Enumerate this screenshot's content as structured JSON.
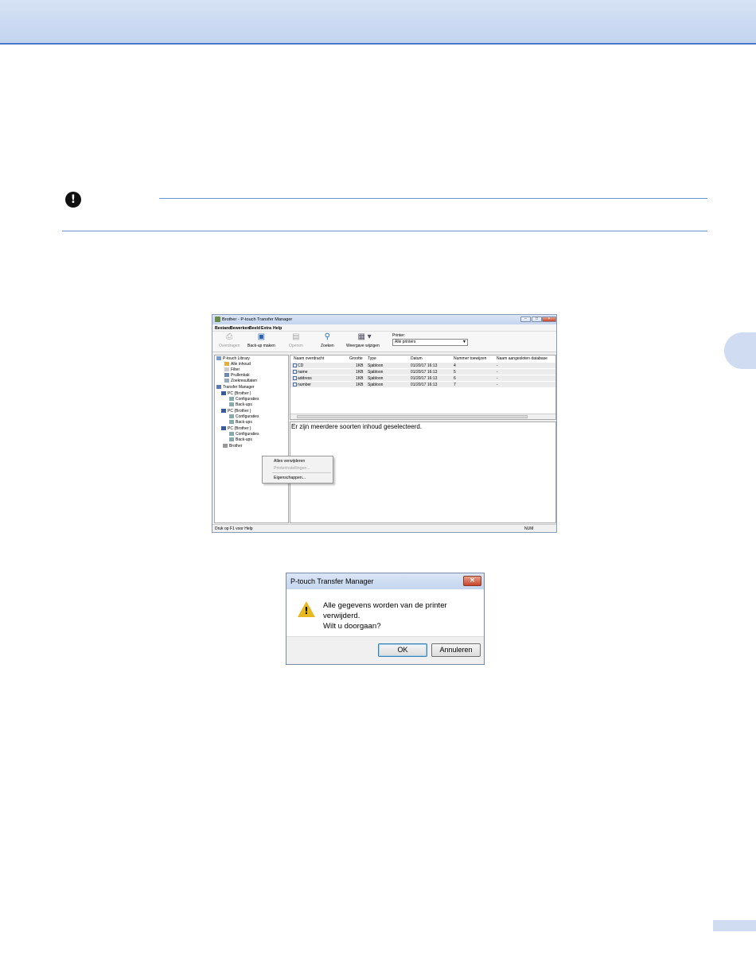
{
  "app": {
    "title": "Brother       - P-touch Transfer Manager",
    "menu": [
      "Bestand",
      "Bewerken",
      "Beeld",
      "Extra",
      "Help"
    ],
    "toolbar": {
      "overdragen": "Overdragen",
      "backup": "Back-up maken",
      "openen": "Openen",
      "zoeken": "Zoeken",
      "weergave": "Weergave wijzigen",
      "printer_label": "Printer:",
      "printer_value": "Alle printers"
    },
    "tree": {
      "library": "P-touch Library",
      "alle_inhoud": "Alle inhoud",
      "filter": "Filter",
      "prullenbak": "Prullenbak",
      "zoekresultaten": "Zoekresultaten",
      "transfer_manager": "Transfer Manager",
      "pc1": "PC (Brother      )",
      "pc2": "PC (Brother      )",
      "pc3": "PC (Brother      )",
      "configuraties": "Configuraties",
      "backups": "Back-ups",
      "brother": "Brother       "
    },
    "list": {
      "columns": [
        "Naam overdracht",
        "Grootte",
        "Type",
        "Datum",
        "Nummer toewijzen",
        "Naam aangesloten database"
      ],
      "rows": [
        {
          "name": "CD",
          "size": "1KB",
          "type": "Sjabloon",
          "date": "01/20/17 16:13",
          "num": "4",
          "db": "-"
        },
        {
          "name": "name",
          "size": "1KB",
          "type": "Sjabloon",
          "date": "01/20/17 16:13",
          "num": "5",
          "db": "-"
        },
        {
          "name": "address",
          "size": "1KB",
          "type": "Sjabloon",
          "date": "01/20/17 16:13",
          "num": "6",
          "db": "-"
        },
        {
          "name": "number",
          "size": "1KB",
          "type": "Sjabloon",
          "date": "01/20/17 16:13",
          "num": "7",
          "db": "-"
        }
      ]
    },
    "preview_text": "Er zijn meerdere soorten inhoud geselecteerd.",
    "context_menu": {
      "delete_all": "Alles verwijderen",
      "printer_settings": "Printerinstellingen...",
      "properties": "Eigenschappen..."
    },
    "status": {
      "help": "Druk op F1 voor Help",
      "num": "NUM"
    }
  },
  "dialog": {
    "title": "P-touch Transfer Manager",
    "message_line1": "Alle gegevens worden van de printer verwijderd.",
    "message_line2": "Wilt u doorgaan?",
    "ok": "OK",
    "cancel": "Annuleren"
  }
}
